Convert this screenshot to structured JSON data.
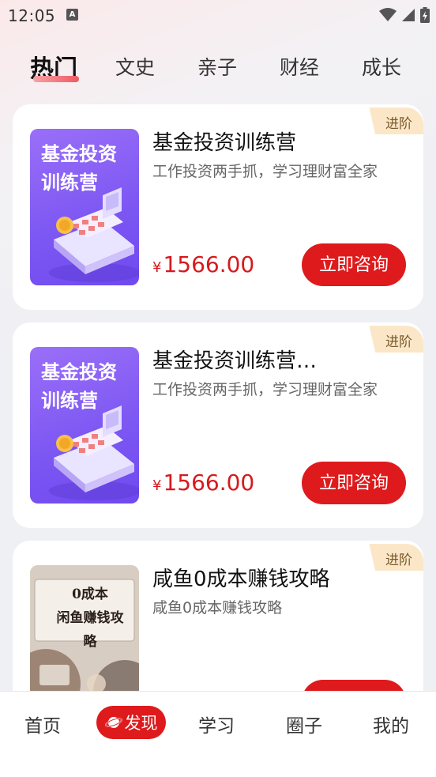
{
  "status_bar": {
    "time": "12:05",
    "notification_icon": "A"
  },
  "tabs": [
    {
      "label": "热门",
      "active": true
    },
    {
      "label": "文史",
      "active": false
    },
    {
      "label": "亲子",
      "active": false
    },
    {
      "label": "财经",
      "active": false
    },
    {
      "label": "成长",
      "active": false
    }
  ],
  "cards": [
    {
      "badge": "进阶",
      "cover_text_line1": "基金投资",
      "cover_text_line2": "训练营",
      "title": "基金投资训练营",
      "subtitle": "工作投资两手抓，学习理财富全家",
      "currency": "¥",
      "price": "1566.00",
      "button": "立即咨询"
    },
    {
      "badge": "进阶",
      "cover_text_line1": "基金投资",
      "cover_text_line2": "训练营",
      "title": "基金投资训练营…",
      "subtitle": "工作投资两手抓，学习理财富全家",
      "currency": "¥",
      "price": "1566.00",
      "button": "立即咨询"
    },
    {
      "badge": "进阶",
      "cover_text_line1": "0成本",
      "cover_text_line2": "闲鱼赚钱攻略",
      "title": "咸鱼0成本赚钱攻略",
      "subtitle": "咸鱼0成本赚钱攻略"
    }
  ],
  "bottom_nav": [
    {
      "label": "首页"
    },
    {
      "label": "发现",
      "active": true
    },
    {
      "label": "学习"
    },
    {
      "label": "圈子"
    },
    {
      "label": "我的"
    }
  ],
  "colors": {
    "accent": "#de1a1c",
    "badge_bg": "#fbe7c8",
    "price": "#d7191d"
  }
}
